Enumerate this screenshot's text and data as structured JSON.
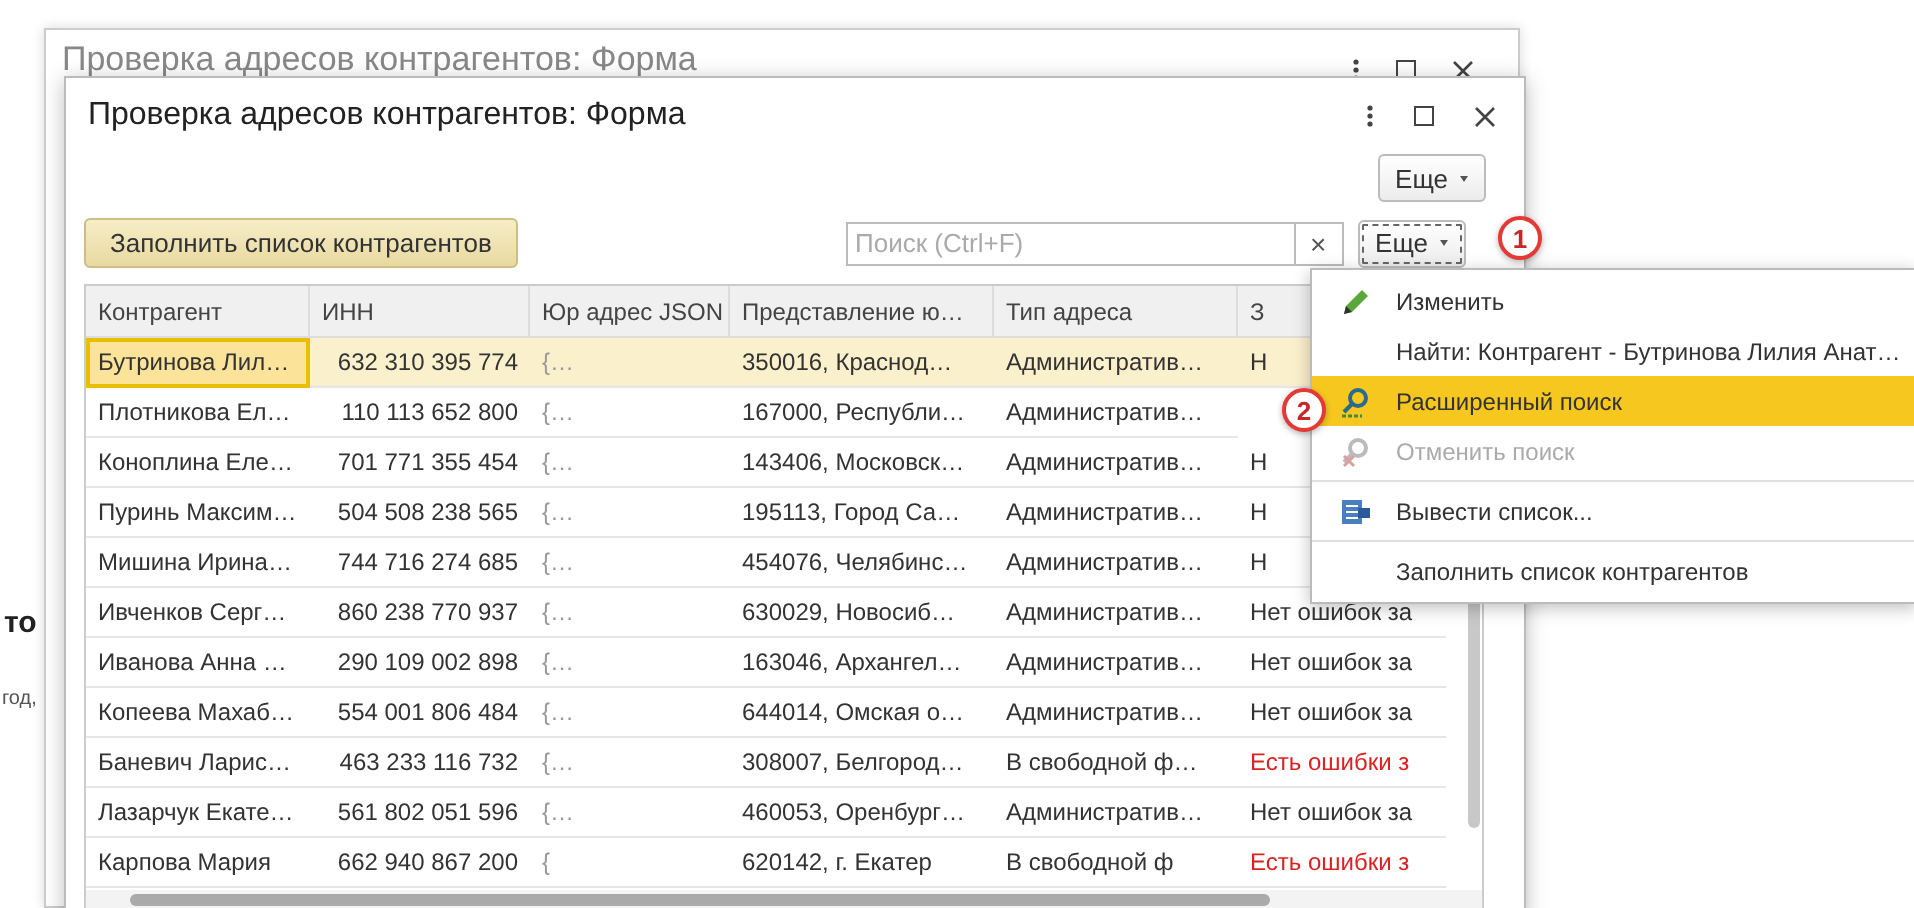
{
  "background_fragments": [
    {
      "text": "то",
      "kind": "bold"
    },
    {
      "text": "год,",
      "kind": "small"
    }
  ],
  "back_window": {
    "title": "Проверка адресов контрагентов: Форма"
  },
  "window": {
    "title": "Проверка адресов контрагентов: Форма",
    "more_button": "Еще",
    "fill_button": "Заполнить список контрагентов",
    "search": {
      "placeholder": "Поиск (Ctrl+F)"
    },
    "clear_button": "×",
    "table_more_button": "Еще"
  },
  "table": {
    "columns": [
      "Контрагент",
      "ИНН",
      "Юр адрес JSON",
      "Представление ю…",
      "Тип адреса",
      "З"
    ],
    "rows": [
      {
        "selected": true,
        "kind": "ok",
        "cells": [
          "Бутринова Лил…",
          "632 310 395 774",
          "{…",
          "350016, Краснод…",
          "Административ…",
          "Н"
        ]
      },
      {
        "selected": false,
        "cells": [
          "Плотникова Ел…",
          "110 113 652 800",
          "{…",
          "167000, Республи…",
          "Административ…"
        ]
      },
      {
        "selected": false,
        "kind": "ok",
        "cells": [
          "Коноплина Еле…",
          "701 771 355 454",
          "{…",
          "143406, Московск…",
          "Административ…",
          "Н"
        ]
      },
      {
        "selected": false,
        "kind": "ok",
        "cells": [
          "Пуринь Максим…",
          "504 508 238 565",
          "{…",
          "195113, Город Са…",
          "Административ…",
          "Н"
        ]
      },
      {
        "selected": false,
        "kind": "ok",
        "cells": [
          "Мишина Ирина…",
          "744 716 274 685",
          "{…",
          "454076, Челябинс…",
          "Административ…",
          "Н"
        ]
      },
      {
        "selected": false,
        "kind": "ok",
        "cells": [
          "Ивченков Серг…",
          "860 238 770 937",
          "{…",
          "630029, Новосиб…",
          "Административ…",
          "Нет ошибок за"
        ]
      },
      {
        "selected": false,
        "kind": "ok",
        "cells": [
          "Иванова Анна …",
          "290 109 002 898",
          "{…",
          "163046, Архангел…",
          "Административ…",
          "Нет ошибок за"
        ]
      },
      {
        "selected": false,
        "kind": "ok",
        "cells": [
          "Копеева Махаб…",
          "554 001 806 484",
          "{…",
          "644014, Омская о…",
          "Административ…",
          "Нет ошибок за"
        ]
      },
      {
        "selected": false,
        "kind": "error",
        "cells": [
          "Баневич Ларис…",
          "463 233 116 732",
          "{…",
          "308007, Белгород…",
          "В свободной ф…",
          "Есть ошибки з"
        ]
      },
      {
        "selected": false,
        "kind": "ok",
        "cells": [
          "Лазарчук Екате…",
          "561 802 051 596",
          "{…",
          "460053, Оренбург…",
          "Административ…",
          "Нет ошибок за"
        ]
      },
      {
        "selected": false,
        "kind": "error",
        "cells": [
          "Карпова Мария",
          "662 940 867 200",
          "{",
          "620142, г. Екатер",
          "В свободной ф",
          "Есть ошибки з"
        ]
      }
    ]
  },
  "menu": {
    "items": [
      {
        "label": "Изменить",
        "kind": "pencil",
        "selected": false,
        "disabled": false,
        "separator_before": false
      },
      {
        "label": "Найти: Контрагент - Бутринова Лилия Анат…",
        "kind": "plain",
        "selected": false,
        "disabled": false,
        "separator_before": false
      },
      {
        "label": "Расширенный поиск",
        "kind": "search",
        "selected": true,
        "disabled": false,
        "separator_before": false
      },
      {
        "label": "Отменить поиск",
        "kind": "search-cancel",
        "selected": false,
        "disabled": true,
        "separator_before": false
      },
      {
        "label": "Вывести список...",
        "kind": "list",
        "selected": false,
        "disabled": false,
        "separator_before": true
      },
      {
        "label": "Заполнить список контрагентов",
        "kind": "plain",
        "selected": false,
        "disabled": false,
        "separator_before": true
      }
    ]
  },
  "callouts": [
    "1",
    "2"
  ]
}
